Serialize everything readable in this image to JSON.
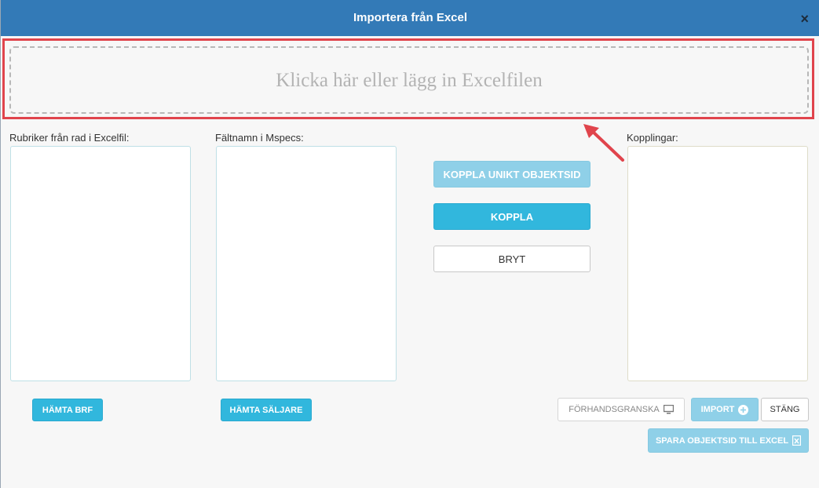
{
  "header": {
    "title": "Importera från Excel",
    "close_symbol": "×"
  },
  "dropzone": {
    "text": "Klicka här eller lägg in Excelfilen"
  },
  "columns": {
    "excel_headers_label": "Rubriker från rad i Excelfil:",
    "mspecs_fields_label": "Fältnamn i Mspecs:",
    "mappings_label": "Kopplingar:"
  },
  "actions": {
    "map_unique_id": "KOPPLA UNIKT OBJEKTSID",
    "map": "KOPPLA",
    "break": "BRYT",
    "fetch_brf": "HÄMTA BRF",
    "fetch_sellers": "HÄMTA SÄLJARE",
    "preview": "FÖRHANDSGRANSKA",
    "import": "IMPORT",
    "close": "STÄNG",
    "save_object_id": "SPARA OBJEKTSID TILL EXCEL"
  },
  "colors": {
    "header_bg": "#337ab7",
    "info_button": "#31b7dd",
    "highlight": "#e0444c"
  },
  "icons": {
    "preview": "monitor-icon",
    "import": "plus-circle-icon",
    "save": "excel-file-icon"
  }
}
